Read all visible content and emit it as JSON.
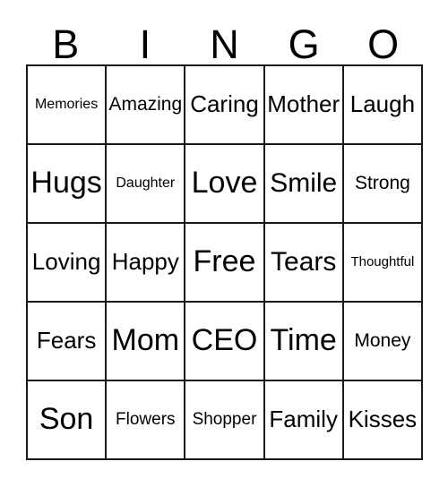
{
  "card": {
    "header_letters": [
      "B",
      "I",
      "N",
      "G",
      "O"
    ],
    "rows": [
      [
        {
          "label": "Memories",
          "size": "fs-xs"
        },
        {
          "label": "Amazing",
          "size": "fs-m"
        },
        {
          "label": "Caring",
          "size": "fs-l"
        },
        {
          "label": "Mother",
          "size": "fs-l"
        },
        {
          "label": "Laugh",
          "size": "fs-l"
        }
      ],
      [
        {
          "label": "Hugs",
          "size": "fs-xxl"
        },
        {
          "label": "Daughter",
          "size": "fs-xs"
        },
        {
          "label": "Love",
          "size": "fs-xxl"
        },
        {
          "label": "Smile",
          "size": "fs-xl"
        },
        {
          "label": "Strong",
          "size": "fs-m"
        }
      ],
      [
        {
          "label": "Loving",
          "size": "fs-l"
        },
        {
          "label": "Happy",
          "size": "fs-l"
        },
        {
          "label": "Free",
          "size": "fs-xxl"
        },
        {
          "label": "Tears",
          "size": "fs-xl"
        },
        {
          "label": "Thoughtful",
          "size": "fs-xxs"
        }
      ],
      [
        {
          "label": "Fears",
          "size": "fs-l"
        },
        {
          "label": "Mom",
          "size": "fs-xxl"
        },
        {
          "label": "CEO",
          "size": "fs-xxl"
        },
        {
          "label": "Time",
          "size": "fs-xxl"
        },
        {
          "label": "Money",
          "size": "fs-m"
        }
      ],
      [
        {
          "label": "Son",
          "size": "fs-xxl"
        },
        {
          "label": "Flowers",
          "size": "fs-s"
        },
        {
          "label": "Shopper",
          "size": "fs-s"
        },
        {
          "label": "Family",
          "size": "fs-l"
        },
        {
          "label": "Kisses",
          "size": "fs-l"
        }
      ]
    ]
  },
  "colors": {
    "border": "#1a1a1a",
    "text": "#000000",
    "background": "#ffffff"
  }
}
